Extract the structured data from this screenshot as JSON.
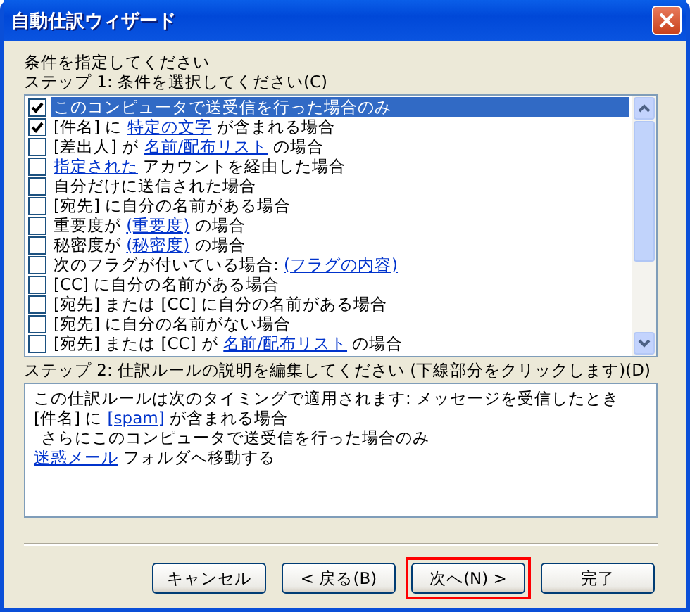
{
  "window": {
    "title": "自動仕訳ウィザード"
  },
  "heading": "条件を指定してください",
  "step1": {
    "label": "ステップ 1: 条件を選択してください(C)",
    "conditions": [
      {
        "checked": true,
        "selected": true,
        "segments": [
          {
            "kind": "text",
            "text": "このコンピュータで送受信を行った場合のみ"
          }
        ]
      },
      {
        "checked": true,
        "selected": false,
        "segments": [
          {
            "kind": "text",
            "text": "[件名] に "
          },
          {
            "kind": "link",
            "text": "特定の文字"
          },
          {
            "kind": "text",
            "text": " が含まれる場合"
          }
        ]
      },
      {
        "checked": false,
        "selected": false,
        "segments": [
          {
            "kind": "text",
            "text": "[差出人] が "
          },
          {
            "kind": "link",
            "text": "名前/配布リスト"
          },
          {
            "kind": "text",
            "text": " の場合"
          }
        ]
      },
      {
        "checked": false,
        "selected": false,
        "segments": [
          {
            "kind": "link",
            "text": "指定された"
          },
          {
            "kind": "text",
            "text": " アカウントを経由した場合"
          }
        ]
      },
      {
        "checked": false,
        "selected": false,
        "segments": [
          {
            "kind": "text",
            "text": "自分だけに送信された場合"
          }
        ]
      },
      {
        "checked": false,
        "selected": false,
        "segments": [
          {
            "kind": "text",
            "text": "[宛先] に自分の名前がある場合"
          }
        ]
      },
      {
        "checked": false,
        "selected": false,
        "segments": [
          {
            "kind": "text",
            "text": "重要度が "
          },
          {
            "kind": "link",
            "text": "(重要度)"
          },
          {
            "kind": "text",
            "text": " の場合"
          }
        ]
      },
      {
        "checked": false,
        "selected": false,
        "segments": [
          {
            "kind": "text",
            "text": "秘密度が "
          },
          {
            "kind": "link",
            "text": "(秘密度)"
          },
          {
            "kind": "text",
            "text": " の場合"
          }
        ]
      },
      {
        "checked": false,
        "selected": false,
        "segments": [
          {
            "kind": "text",
            "text": "次のフラグが付いている場合: "
          },
          {
            "kind": "link",
            "text": "(フラグの内容)"
          }
        ]
      },
      {
        "checked": false,
        "selected": false,
        "segments": [
          {
            "kind": "text",
            "text": "[CC] に自分の名前がある場合"
          }
        ]
      },
      {
        "checked": false,
        "selected": false,
        "segments": [
          {
            "kind": "text",
            "text": "[宛先] または [CC] に自分の名前がある場合"
          }
        ]
      },
      {
        "checked": false,
        "selected": false,
        "segments": [
          {
            "kind": "text",
            "text": "[宛先] に自分の名前がない場合"
          }
        ]
      },
      {
        "checked": false,
        "selected": false,
        "segments": [
          {
            "kind": "text",
            "text": "[宛先] または [CC] が "
          },
          {
            "kind": "link",
            "text": "名前/配布リスト"
          },
          {
            "kind": "text",
            "text": " の場合"
          }
        ]
      }
    ]
  },
  "step2": {
    "label": "ステップ 2: 仕訳ルールの説明を編集してください (下線部分をクリックします)(D)",
    "lines": [
      {
        "segments": [
          {
            "kind": "text",
            "text": "この仕訳ルールは次のタイミングで適用されます: メッセージを受信したとき"
          }
        ]
      },
      {
        "segments": [
          {
            "kind": "text",
            "text": "[件名] に "
          },
          {
            "kind": "link",
            "text": "[spam]"
          },
          {
            "kind": "text",
            "text": " が含まれる場合"
          }
        ],
        "children": [
          {
            "segments": [
              {
                "kind": "text",
                "text": "さらにこのコンピュータで送受信を行った場合のみ"
              }
            ]
          }
        ]
      },
      {
        "segments": [
          {
            "kind": "link",
            "text": "迷惑メール"
          },
          {
            "kind": "text",
            "text": " フォルダへ移動する"
          }
        ]
      }
    ]
  },
  "buttons": [
    {
      "label": "キャンセル",
      "highlighted": false
    },
    {
      "label": "< 戻る(B)",
      "highlighted": false
    },
    {
      "label": "次へ(N) >",
      "highlighted": true
    },
    {
      "label": "完了",
      "highlighted": false
    }
  ]
}
